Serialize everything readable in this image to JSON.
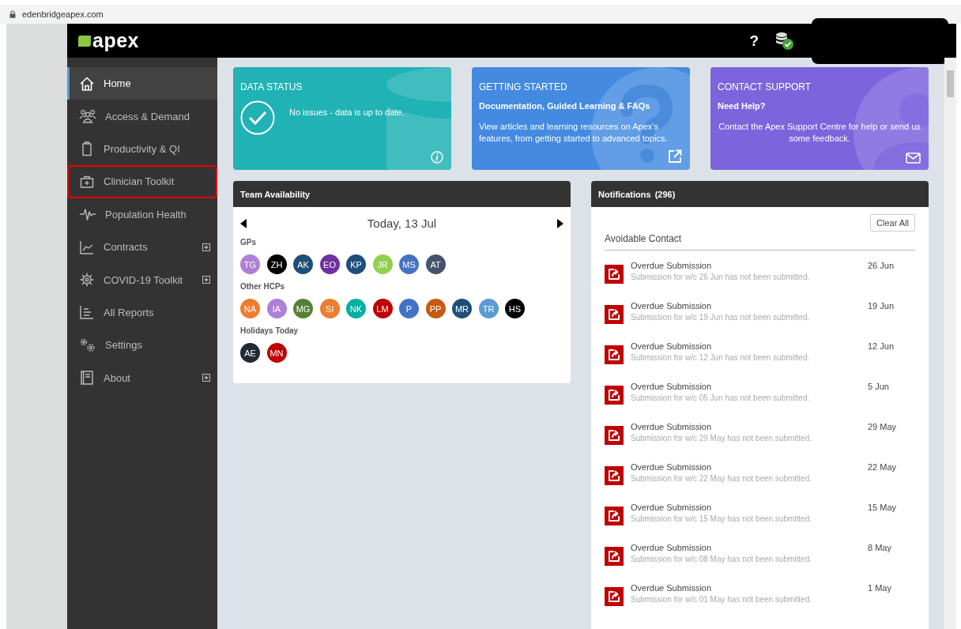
{
  "browser": {
    "url": "edenbridgeapex.com"
  },
  "header": {
    "logo": "apex",
    "help": "?"
  },
  "sidebar": {
    "items": [
      {
        "label": "Home",
        "selected": true,
        "highlighted": false,
        "expandable": false
      },
      {
        "label": "Access & Demand",
        "selected": false,
        "highlighted": false,
        "expandable": false
      },
      {
        "label": "Productivity & QI",
        "selected": false,
        "highlighted": false,
        "expandable": false
      },
      {
        "label": "Clinician Toolkit",
        "selected": false,
        "highlighted": true,
        "expandable": false
      },
      {
        "label": "Population Health",
        "selected": false,
        "highlighted": false,
        "expandable": false
      },
      {
        "label": "Contracts",
        "selected": false,
        "highlighted": false,
        "expandable": true
      },
      {
        "label": "COVID-19 Toolkit",
        "selected": false,
        "highlighted": false,
        "expandable": true
      },
      {
        "label": "All Reports",
        "selected": false,
        "highlighted": false,
        "expandable": false
      },
      {
        "label": "Settings",
        "selected": false,
        "highlighted": false,
        "expandable": false
      },
      {
        "label": "About",
        "selected": false,
        "highlighted": false,
        "expandable": true
      }
    ]
  },
  "cards": [
    {
      "kind": "status",
      "title": "DATA STATUS",
      "message": "No issues - data is up to date."
    },
    {
      "kind": "guide",
      "title": "GETTING STARTED",
      "subtitle": "Documentation, Guided Learning & FAQs",
      "body": "View articles and learning resources on Apex’s features, from getting started to advanced topics."
    },
    {
      "kind": "support",
      "title": "CONTACT SUPPORT",
      "subtitle": "Need Help?",
      "body": "Contact the Apex Support Centre for help or send us some feedback."
    }
  ],
  "team_availability": {
    "title": "Team Availability",
    "date": "Today, 13 Jul",
    "groups": [
      {
        "label": "GPs",
        "people": [
          {
            "initials": "TG",
            "color": "#b07fd8"
          },
          {
            "initials": "ZH",
            "color": "#000000"
          },
          {
            "initials": "AK",
            "color": "#1f4e79"
          },
          {
            "initials": "EO",
            "color": "#7030a0"
          },
          {
            "initials": "KP",
            "color": "#1f4e79"
          },
          {
            "initials": "JR",
            "color": "#92d050"
          },
          {
            "initials": "MS",
            "color": "#4472c4"
          },
          {
            "initials": "AT",
            "color": "#44546a"
          }
        ]
      },
      {
        "label": "Other HCPs",
        "people": [
          {
            "initials": "NA",
            "color": "#ed7d31"
          },
          {
            "initials": "IA",
            "color": "#b07fd8"
          },
          {
            "initials": "MG",
            "color": "#548235"
          },
          {
            "initials": "SI",
            "color": "#ed7d31"
          },
          {
            "initials": "NK",
            "color": "#00b0a0"
          },
          {
            "initials": "LM",
            "color": "#c00000"
          },
          {
            "initials": "P",
            "color": "#4472c4"
          },
          {
            "initials": "PP",
            "color": "#c55a11"
          },
          {
            "initials": "MR",
            "color": "#1f4e79"
          },
          {
            "initials": "TR",
            "color": "#5b9bd5"
          },
          {
            "initials": "HS",
            "color": "#000000"
          }
        ]
      },
      {
        "label": "Holidays Today",
        "people": [
          {
            "initials": "AE",
            "color": "#222a35"
          },
          {
            "initials": "MN",
            "color": "#c00000"
          }
        ]
      }
    ]
  },
  "notifications": {
    "title": "Notifications",
    "count": "(296)",
    "clear_button": "Clear All",
    "section": "Avoidable Contact",
    "items": [
      {
        "title": "Overdue Submission",
        "detail": "Submission for w/c 26 Jun has not been submitted.",
        "date": "26 Jun"
      },
      {
        "title": "Overdue Submission",
        "detail": "Submission for w/c 19 Jun has not been submitted.",
        "date": "19 Jun"
      },
      {
        "title": "Overdue Submission",
        "detail": "Submission for w/c 12 Jun has not been submitted.",
        "date": "12 Jun"
      },
      {
        "title": "Overdue Submission",
        "detail": "Submission for w/c 05 Jun has not been submitted.",
        "date": "5 Jun"
      },
      {
        "title": "Overdue Submission",
        "detail": "Submission for w/c 29 May has not been submitted.",
        "date": "29 May"
      },
      {
        "title": "Overdue Submission",
        "detail": "Submission for w/c 22 May has not been submitted.",
        "date": "22 May"
      },
      {
        "title": "Overdue Submission",
        "detail": "Submission for w/c 15 May has not been submitted.",
        "date": "15 May"
      },
      {
        "title": "Overdue Submission",
        "detail": "Submission for w/c 08 May has not been submitted.",
        "date": "8 May"
      },
      {
        "title": "Overdue Submission",
        "detail": "Submission for w/c 01 May has not been submitted.",
        "date": "1 May"
      }
    ]
  }
}
